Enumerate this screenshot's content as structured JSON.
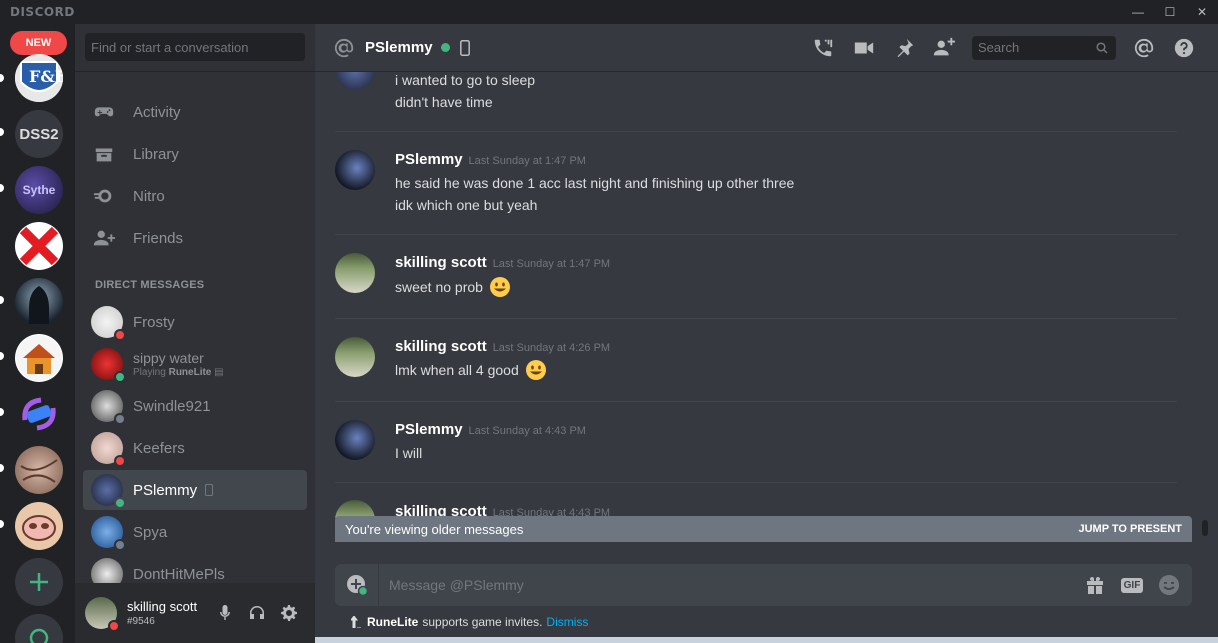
{
  "app": {
    "brand": "DISCORD",
    "window_controls": [
      "minimize",
      "maximize",
      "close"
    ]
  },
  "rail": {
    "new_badge": "NEW",
    "servers": [
      {
        "label": "F&E",
        "kind": "image"
      },
      {
        "label": "DSS2",
        "kind": "text"
      },
      {
        "label": "Sythe",
        "kind": "image"
      },
      {
        "label": "",
        "kind": "image"
      },
      {
        "label": "",
        "kind": "image"
      },
      {
        "label": "",
        "kind": "image"
      },
      {
        "label": "",
        "kind": "image"
      },
      {
        "label": "",
        "kind": "image"
      },
      {
        "label": "",
        "kind": "image"
      }
    ],
    "add_server_icon": "plus-icon",
    "explore_icon": "compass-icon"
  },
  "sidebar": {
    "search_placeholder": "Find or start a conversation",
    "nav": [
      {
        "label": "Activity",
        "icon": "controller-icon"
      },
      {
        "label": "Library",
        "icon": "library-icon"
      },
      {
        "label": "Nitro",
        "icon": "nitro-icon"
      },
      {
        "label": "Friends",
        "icon": "friends-icon"
      }
    ],
    "dm_header": "DIRECT MESSAGES",
    "dms": [
      {
        "name": "Frosty",
        "sub": "",
        "status": "dnd"
      },
      {
        "name": "sippy water",
        "sub_prefix": "Playing",
        "sub_game": "RuneLite",
        "status": "online"
      },
      {
        "name": "Swindle921",
        "sub": "",
        "status": "offline"
      },
      {
        "name": "Keefers",
        "sub": "",
        "status": "dnd"
      },
      {
        "name": "PSlemmy",
        "sub": "",
        "status": "online",
        "active": true,
        "mobile": true
      },
      {
        "name": "Spya",
        "sub": "",
        "status": "offline"
      },
      {
        "name": "DontHitMePls",
        "sub": "",
        "status": "offline"
      }
    ],
    "user": {
      "name": "skilling scott",
      "tag": "#9546",
      "status": "dnd"
    }
  },
  "chat": {
    "header": {
      "name": "PSlemmy",
      "status": "online",
      "search_placeholder": "Search"
    },
    "messages": [
      {
        "author": "",
        "timestamp": "",
        "lines": [
          "i wanted to go to sleep",
          "didn't have time"
        ]
      },
      {
        "author": "PSlemmy",
        "timestamp": "Last Sunday at 1:47 PM",
        "lines": [
          "he said he was done 1 acc last night and finishing up other three",
          "idk which one but yeah"
        ]
      },
      {
        "author": "skilling scott",
        "timestamp": "Last Sunday at 1:47 PM",
        "lines": [
          "sweet no prob"
        ],
        "emoji": "smiley"
      },
      {
        "author": "skilling scott",
        "timestamp": "Last Sunday at 4:26 PM",
        "lines": [
          "lmk when all 4 good"
        ],
        "emoji": "smiley"
      },
      {
        "author": "PSlemmy",
        "timestamp": "Last Sunday at 4:43 PM",
        "lines": [
          "I will"
        ]
      },
      {
        "author": "skilling scott",
        "timestamp": "Last Sunday at 4:43 PM",
        "lines": []
      }
    ],
    "older_bar": {
      "text": "You're viewing older messages",
      "jump": "JUMP TO PRESENT"
    },
    "composer": {
      "placeholder": "Message @PSlemmy",
      "gif_label": "GIF"
    },
    "notice": {
      "game": "RuneLite",
      "text": "supports game invites.",
      "dismiss": "Dismiss"
    }
  },
  "colors": {
    "online": "#43b581",
    "dnd": "#f04747",
    "offline": "#747f8d",
    "link": "#00b0f4"
  }
}
